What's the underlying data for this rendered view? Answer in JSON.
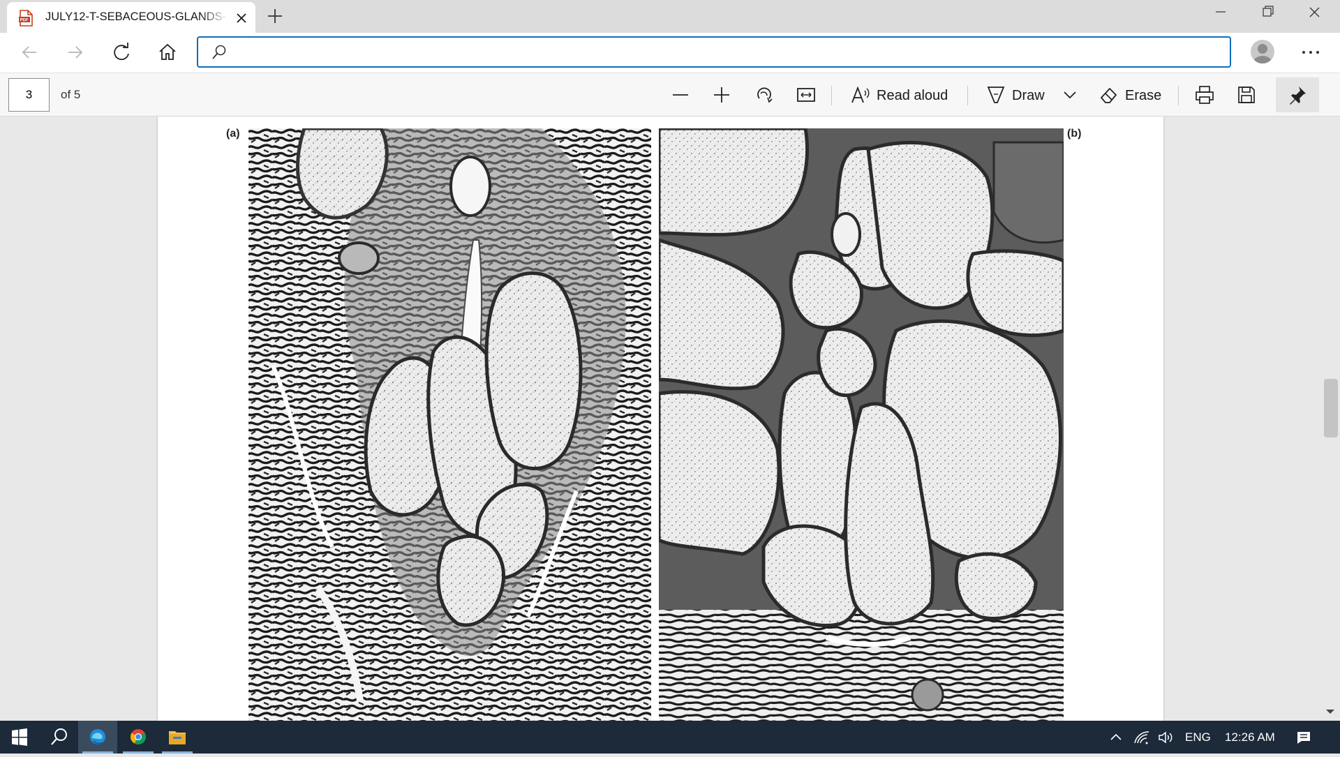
{
  "browser": {
    "tab": {
      "title": "JULY12-T-SEBACEOUS-GLANDS-",
      "icon": "pdf-file-icon"
    },
    "address_bar": {
      "value": "",
      "placeholder": ""
    },
    "accent_color": "#0f6cbd"
  },
  "pdf_toolbar": {
    "page_current": "3",
    "page_total_label": "of 5",
    "read_aloud_label": "Read aloud",
    "draw_label": "Draw",
    "erase_label": "Erase"
  },
  "document": {
    "panel_a_label": "(a)",
    "panel_b_label": "(b)"
  },
  "taskbar": {
    "language": "ENG",
    "time": "12:26 AM",
    "apps": [
      "windows-start-icon",
      "search-icon",
      "edge-browser-icon",
      "chrome-browser-icon",
      "file-explorer-icon"
    ]
  }
}
